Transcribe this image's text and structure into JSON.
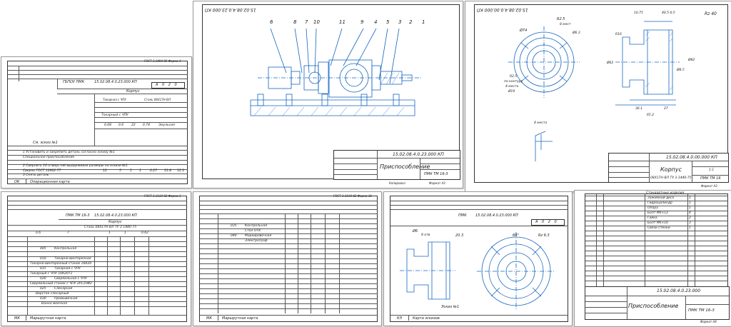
{
  "sheet1": {
    "gost_header": "ГОСТ 3.1404-86 Форма 3",
    "org": "ГБПОУ ПМК",
    "doc_code": "15.02.08.4.0.23.000 КП",
    "part_name": "Корпус",
    "section": "Токарная с ЧПУ",
    "machine": "Токарный с ЧПУ",
    "material": "Сталь 08Х17Н-ВЛ",
    "op_no": "А 0 2 0",
    "values_row": [
      "0.08",
      "0.6",
      "22",
      "0.74",
      "Эмульсия"
    ],
    "sketch_label": "См. эскиз №1",
    "steps": [
      "1 Установить и закрепить деталь согласно эскизу №1",
      "Специальное приспособление",
      "2 Сверлить 16 отверстий выдерживая размеры на эскизе №1",
      "Сверло ГОСТ 10902-77",
      "3 Снять деталь"
    ],
    "step_values": [
      "12",
      "5",
      "1",
      "1",
      "0.27",
      "31.8",
      "12.3"
    ],
    "footer_code": "ОК",
    "footer_title": "Операционная карта"
  },
  "sheet2": {
    "stamp_code_rotated": "15.02.08.4.0.23.000 КП",
    "callouts": [
      "6",
      "8",
      "7",
      "10",
      "11",
      "9",
      "4",
      "5",
      "3",
      "2",
      "1"
    ],
    "doc_code": "15.02.08.4.0.23.000 КП",
    "title": "Приспособление",
    "org": "ПМК ТМ 16-3",
    "format_note": "Копировал",
    "format": "Формат А3"
  },
  "sheet3": {
    "stamp_code_rotated": "15.02.08.4.0.00.000 КП",
    "roughness": "Rz 40",
    "dims": [
      "Ø74",
      "R2.5",
      "8 мест",
      "Ø6.3",
      "R2.5",
      "по контуру",
      "4 места",
      "Ø19",
      "4 места",
      "10.75",
      "40.5-0.5",
      "R16",
      "Ø82",
      "Ø8.5",
      "Ø62",
      "36.1",
      "27",
      "65.2"
    ],
    "doc_code": "15.02.08.4.0.00.000 КП",
    "title": "Корпус",
    "material": "08Х17Н-ВЛ ТУ 3-1440-75",
    "org": "ПМК ТМ 16",
    "sheet_no": "1:1",
    "format": "Формат А3"
  },
  "sheet4": {
    "gost_header": "ГОСТ 3.1118-82 Форма 1",
    "org": "ПМК ТМ 16-3",
    "doc_code": "15.02.08.4.0.23.000 КП",
    "part_name": "Корпус",
    "material": "Сталь 08Х17Н-ВЛ ТУ 3-1440-75",
    "code_row": [
      "0.6",
      "7",
      "1",
      "1",
      "0.62"
    ],
    "operations": [
      {
        "code": "005",
        "name": "Контрольная"
      },
      {
        "code": "010",
        "name": "Токарно-винторезная"
      },
      {
        "code": "",
        "name": "Токарно-винторезный станок 16К20"
      },
      {
        "code": "015",
        "name": "Токарная с ЧПУ"
      },
      {
        "code": "",
        "name": "Токарный с ЧПУ 16К20Т1"
      },
      {
        "code": "020",
        "name": "Сверлильная с ЧПУ"
      },
      {
        "code": "",
        "name": "Сверлильный станок с ЧПУ 2Р135Ф2"
      },
      {
        "code": "025",
        "name": "Слесарная"
      },
      {
        "code": "",
        "name": "Верстак слесарный"
      },
      {
        "code": "030",
        "name": "Промывочная"
      },
      {
        "code": "",
        "name": "Ванна моечная"
      }
    ],
    "footer_code": "МК",
    "footer_title": "Маршрутная карта"
  },
  "sheet5": {
    "gost_header": "ГОСТ 3.1118-82 Форма 1б",
    "operations": [
      {
        "code": "035",
        "name": "Контрольная"
      },
      {
        "code": "",
        "name": "Стол ОТК"
      },
      {
        "code": "040",
        "name": "Маркировочная"
      },
      {
        "code": "",
        "name": "Электрограф"
      }
    ],
    "footer_code": "МК",
    "footer_title": "Маршрутная карта"
  },
  "sheet6": {
    "org": "ПМК",
    "doc_code": "15.02.08.4.0.23.000 КП",
    "op_no": "А 0 2 0",
    "dims": [
      "Ø6",
      "8 отв",
      "20.3",
      "60°",
      "Rz 6.3"
    ],
    "sketch_label": "Эскиз №1",
    "footer_code": "КЭ",
    "footer_title": "Карта эскизов"
  },
  "sheet7": {
    "spec_header": "Стандартные изделия",
    "items": [
      {
        "name": "Зажимной диск",
        "qty": "1"
      },
      {
        "name": "Гидроцилиндр",
        "qty": "1"
      },
      {
        "name": "Опора",
        "qty": "1"
      },
      {
        "name": "Болт М6×12",
        "qty": "4"
      },
      {
        "name": "Гайка",
        "qty": "2"
      },
      {
        "name": "Болт М6×16",
        "qty": "3"
      },
      {
        "name": "Связи стенки",
        "qty": "1"
      }
    ],
    "doc_code": "15.02.08.4.0.23.000",
    "title": "Приспособление",
    "org": "ПМК ТМ 16-3",
    "format": "Формат А4"
  }
}
